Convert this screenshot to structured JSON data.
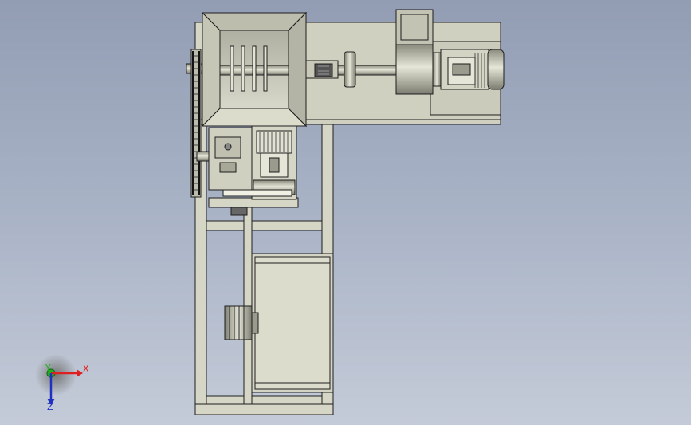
{
  "colors": {
    "background_top": "#929db4",
    "background_bottom": "#c4cbd8",
    "part_fill": "#d6d6c6",
    "part_shade": "#a8a898",
    "outline": "#1e1e1e",
    "axis_x": "#e02020",
    "axis_y": "#20b020",
    "axis_z": "#2030c0"
  },
  "triad": {
    "x_label": "X",
    "y_label": "Y",
    "z_label": "Z"
  }
}
